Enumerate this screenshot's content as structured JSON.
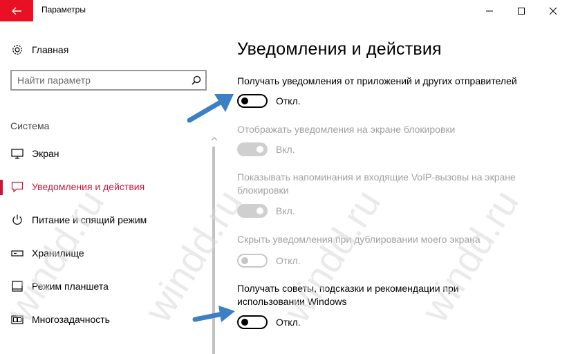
{
  "window": {
    "title": "Параметры",
    "back_icon": "back-arrow-icon",
    "accent_color": "#e81123"
  },
  "sidebar": {
    "home_label": "Главная",
    "search_placeholder": "Найти параметр",
    "group_header": "Система",
    "items": [
      {
        "label": "Экран",
        "icon": "monitor-icon",
        "active": false
      },
      {
        "label": "Уведомления и действия",
        "icon": "notification-icon",
        "active": true
      },
      {
        "label": "Питание и спящий режим",
        "icon": "power-icon",
        "active": false
      },
      {
        "label": "Хранилище",
        "icon": "storage-icon",
        "active": false
      },
      {
        "label": "Режим планшета",
        "icon": "tablet-icon",
        "active": false
      },
      {
        "label": "Многозадачность",
        "icon": "multitasking-icon",
        "active": false
      }
    ],
    "active_color": "#c4193b"
  },
  "main": {
    "title": "Уведомления и действия",
    "settings": [
      {
        "description": "Получать уведомления от приложений и других отправителей",
        "state": "Откл.",
        "enabled": true,
        "on": false
      },
      {
        "description": "Отображать уведомления на экране блокировки",
        "state": "Вкл.",
        "enabled": false,
        "on": true
      },
      {
        "description": "Показывать напоминания и входящие VoIP-вызовы на экране блокировки",
        "state": "Вкл.",
        "enabled": false,
        "on": true
      },
      {
        "description": "Скрыть уведомления при дублировании моего экрана",
        "state": "Откл.",
        "enabled": false,
        "on": false
      },
      {
        "description": "Получать советы, подсказки и рекомендации при использовании Windows",
        "state": "Откл.",
        "enabled": true,
        "on": false
      }
    ]
  },
  "watermark": {
    "text": "windd.ru",
    "color": "#d9d9d9"
  },
  "annotation": {
    "arrow_color": "#3b7fc4"
  }
}
